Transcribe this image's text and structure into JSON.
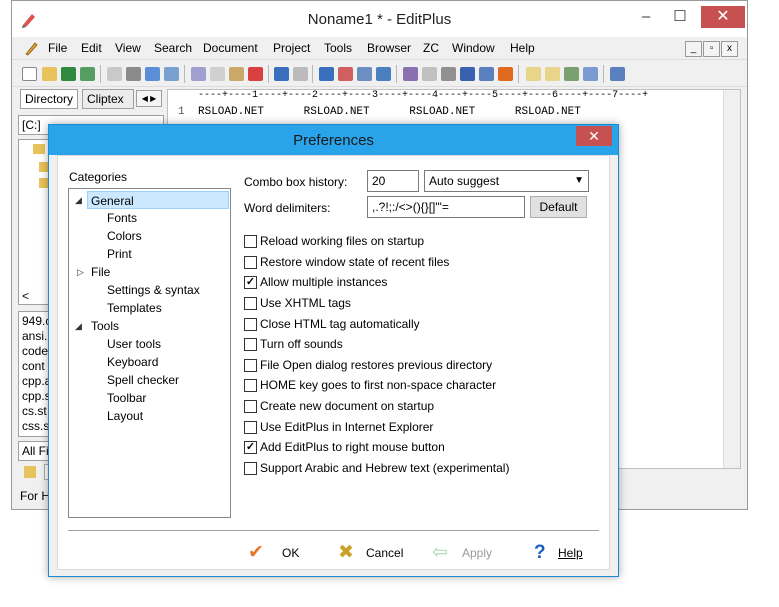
{
  "window": {
    "title": "Noname1 * - EditPlus",
    "min_glyph": "–",
    "max_glyph": "☐",
    "close_glyph": "✕"
  },
  "menu": [
    "File",
    "Edit",
    "View",
    "Search",
    "Document",
    "Project",
    "Tools",
    "Browser",
    "ZC",
    "Window",
    "Help"
  ],
  "left_panel": {
    "tab_directory": "Directory",
    "tab_cliptext": "Cliptex",
    "drive": "[C:]",
    "scroll_left_glyph": "<",
    "files": [
      "949.c",
      "ansi.",
      "code",
      "cont",
      "cpp.a",
      "cpp.s",
      "cs.st",
      "css.s"
    ],
    "filter": "All Fi",
    "status": "For H"
  },
  "editor": {
    "ruler": "----+----1----+----2----+----3----+----4----+----5----+----6----+----7----+",
    "line_number": "1",
    "line_text": "RSLOAD.NET      RSLOAD.NET      RSLOAD.NET      RSLOAD.NET"
  },
  "dialog": {
    "title": "Preferences",
    "close_glyph": "✕",
    "categories_label": "Categories",
    "tree": [
      {
        "label": "General",
        "level": 0,
        "arrow": "◢",
        "selected": true
      },
      {
        "label": "Fonts",
        "level": 1
      },
      {
        "label": "Colors",
        "level": 1
      },
      {
        "label": "Print",
        "level": 1
      },
      {
        "label": "File",
        "level": 0,
        "arrow": "▷"
      },
      {
        "label": "Settings & syntax",
        "level": 1
      },
      {
        "label": "Templates",
        "level": 1
      },
      {
        "label": "Tools",
        "level": 0,
        "arrow": "◢"
      },
      {
        "label": "User tools",
        "level": 1
      },
      {
        "label": "Keyboard",
        "level": 1
      },
      {
        "label": "Spell checker",
        "level": 1
      },
      {
        "label": "Toolbar",
        "level": 1
      },
      {
        "label": "Layout",
        "level": 1
      }
    ],
    "combo_history_label": "Combo box history:",
    "combo_history_value": "20",
    "auto_suggest_value": "Auto suggest",
    "word_delimiters_label": "Word delimiters:",
    "word_delimiters_value": ",.?!;:/<>(){}[]\"'=",
    "default_button": "Default",
    "options": [
      {
        "label": "Reload working files on startup",
        "checked": false
      },
      {
        "label": "Restore window state of recent files",
        "checked": false
      },
      {
        "label": "Allow multiple instances",
        "checked": true
      },
      {
        "label": "Use XHTML tags",
        "checked": false
      },
      {
        "label": "Close HTML tag automatically",
        "checked": false
      },
      {
        "label": "Turn off sounds",
        "checked": false
      },
      {
        "label": "File Open dialog restores previous directory",
        "checked": false
      },
      {
        "label": "HOME key goes to first non-space character",
        "checked": false
      },
      {
        "label": "Create new document on startup",
        "checked": false
      },
      {
        "label": "Use EditPlus in Internet Explorer",
        "checked": false
      },
      {
        "label": "Add EditPlus to right mouse button",
        "checked": true
      },
      {
        "label": "Support Arabic and Hebrew text (experimental)",
        "checked": false
      }
    ],
    "check_glyph": "✓",
    "ok": "OK",
    "cancel": "Cancel",
    "apply": "Apply",
    "help": "Help",
    "ok_glyph": "✔",
    "cancel_glyph": "✖",
    "apply_glyph": "⇦",
    "help_glyph": "?",
    "colors": {
      "accent": "#29a3ea",
      "ok": "#e8772e",
      "cancel": "#c9a227",
      "apply": "#a8d5a8",
      "help": "#1c5fbf"
    }
  }
}
